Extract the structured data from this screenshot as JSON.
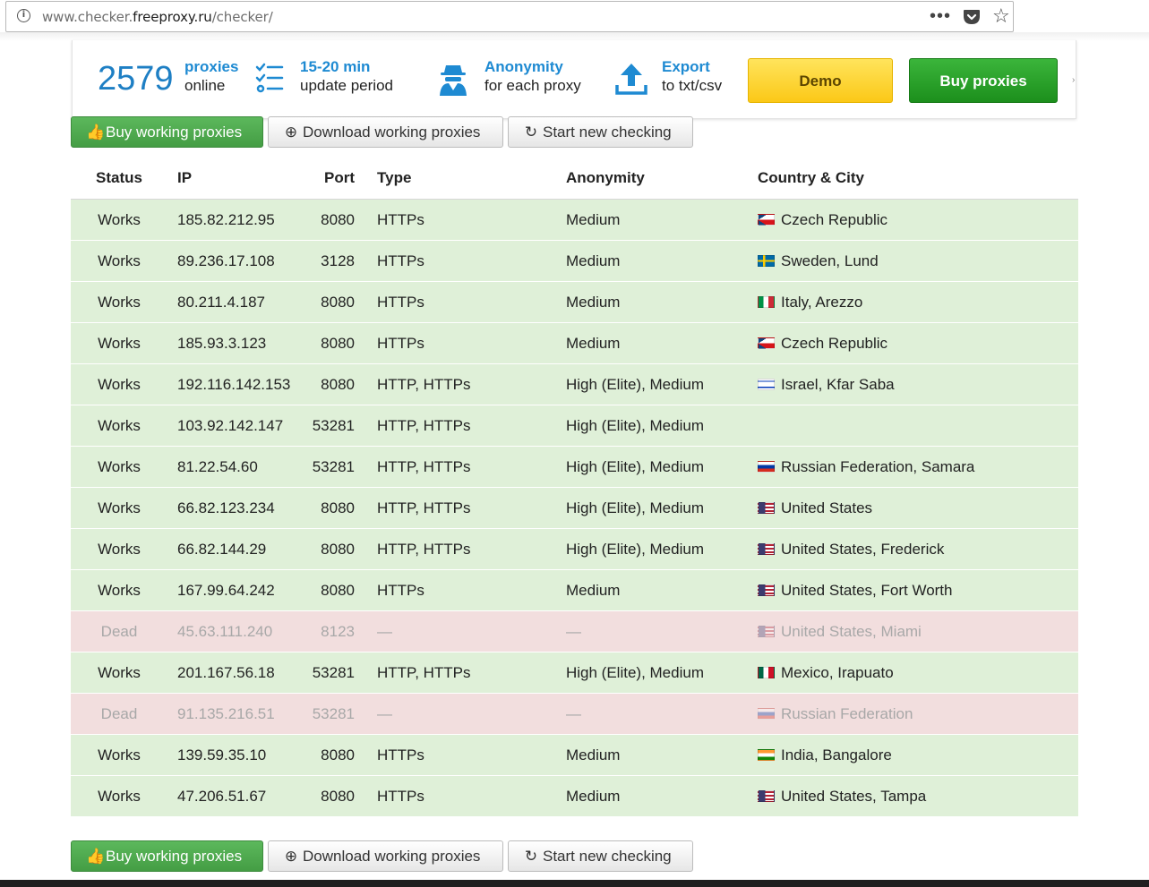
{
  "browser": {
    "url_prefix": "www.checker.",
    "url_host": "freeproxy.ru",
    "url_suffix": "/checker/"
  },
  "promo": {
    "count": "2579",
    "count_title": "proxies",
    "count_sub": "online",
    "period_title": "15-20 min",
    "period_sub": "update period",
    "anon_title": "Anonymity",
    "anon_sub": "for each proxy",
    "export_title": "Export",
    "export_sub": "to txt/csv",
    "demo_label": "Demo",
    "buy_label": "Buy proxies"
  },
  "actions": {
    "buy_working": "Buy working proxies",
    "download_working": "Download working proxies",
    "start_new": "Start new checking"
  },
  "table": {
    "headers": {
      "status": "Status",
      "ip": "IP",
      "port": "Port",
      "type": "Type",
      "anonymity": "Anonymity",
      "country": "Country & City"
    },
    "rows": [
      {
        "status": "Works",
        "ip": "185.82.212.95",
        "port": "8080",
        "type": "HTTPs",
        "anonymity": "Medium",
        "flag": "cz",
        "country": "Czech Republic"
      },
      {
        "status": "Works",
        "ip": "89.236.17.108",
        "port": "3128",
        "type": "HTTPs",
        "anonymity": "Medium",
        "flag": "se",
        "country": "Sweden, Lund"
      },
      {
        "status": "Works",
        "ip": "80.211.4.187",
        "port": "8080",
        "type": "HTTPs",
        "anonymity": "Medium",
        "flag": "it",
        "country": "Italy, Arezzo"
      },
      {
        "status": "Works",
        "ip": "185.93.3.123",
        "port": "8080",
        "type": "HTTPs",
        "anonymity": "Medium",
        "flag": "cz",
        "country": "Czech Republic"
      },
      {
        "status": "Works",
        "ip": "192.116.142.153",
        "port": "8080",
        "type": "HTTP, HTTPs",
        "anonymity": "High (Elite), Medium",
        "flag": "il",
        "country": "Israel, Kfar Saba"
      },
      {
        "status": "Works",
        "ip": "103.92.142.147",
        "port": "53281",
        "type": "HTTP, HTTPs",
        "anonymity": "High (Elite), Medium",
        "flag": "",
        "country": ""
      },
      {
        "status": "Works",
        "ip": "81.22.54.60",
        "port": "53281",
        "type": "HTTP, HTTPs",
        "anonymity": "High (Elite), Medium",
        "flag": "ru",
        "country": "Russian Federation, Samara"
      },
      {
        "status": "Works",
        "ip": "66.82.123.234",
        "port": "8080",
        "type": "HTTP, HTTPs",
        "anonymity": "High (Elite), Medium",
        "flag": "us",
        "country": "United States"
      },
      {
        "status": "Works",
        "ip": "66.82.144.29",
        "port": "8080",
        "type": "HTTP, HTTPs",
        "anonymity": "High (Elite), Medium",
        "flag": "us",
        "country": "United States, Frederick"
      },
      {
        "status": "Works",
        "ip": "167.99.64.242",
        "port": "8080",
        "type": "HTTPs",
        "anonymity": "Medium",
        "flag": "us",
        "country": "United States, Fort Worth"
      },
      {
        "status": "Dead",
        "ip": "45.63.111.240",
        "port": "8123",
        "type": "—",
        "anonymity": "—",
        "flag": "us",
        "country": "United States, Miami"
      },
      {
        "status": "Works",
        "ip": "201.167.56.18",
        "port": "53281",
        "type": "HTTP, HTTPs",
        "anonymity": "High (Elite), Medium",
        "flag": "mx",
        "country": "Mexico, Irapuato"
      },
      {
        "status": "Dead",
        "ip": "91.135.216.51",
        "port": "53281",
        "type": "—",
        "anonymity": "—",
        "flag": "ru",
        "country": "Russian Federation"
      },
      {
        "status": "Works",
        "ip": "139.59.35.10",
        "port": "8080",
        "type": "HTTPs",
        "anonymity": "Medium",
        "flag": "in",
        "country": "India, Bangalore"
      },
      {
        "status": "Works",
        "ip": "47.206.51.67",
        "port": "8080",
        "type": "HTTPs",
        "anonymity": "Medium",
        "flag": "us",
        "country": "United States, Tampa"
      }
    ]
  },
  "colors": {
    "works_bg": "#dff0d8",
    "dead_bg": "#f2dede",
    "accent_blue": "#1e8ad2",
    "buy_green": "#1c8f1c",
    "demo_yellow": "#fbc817"
  }
}
